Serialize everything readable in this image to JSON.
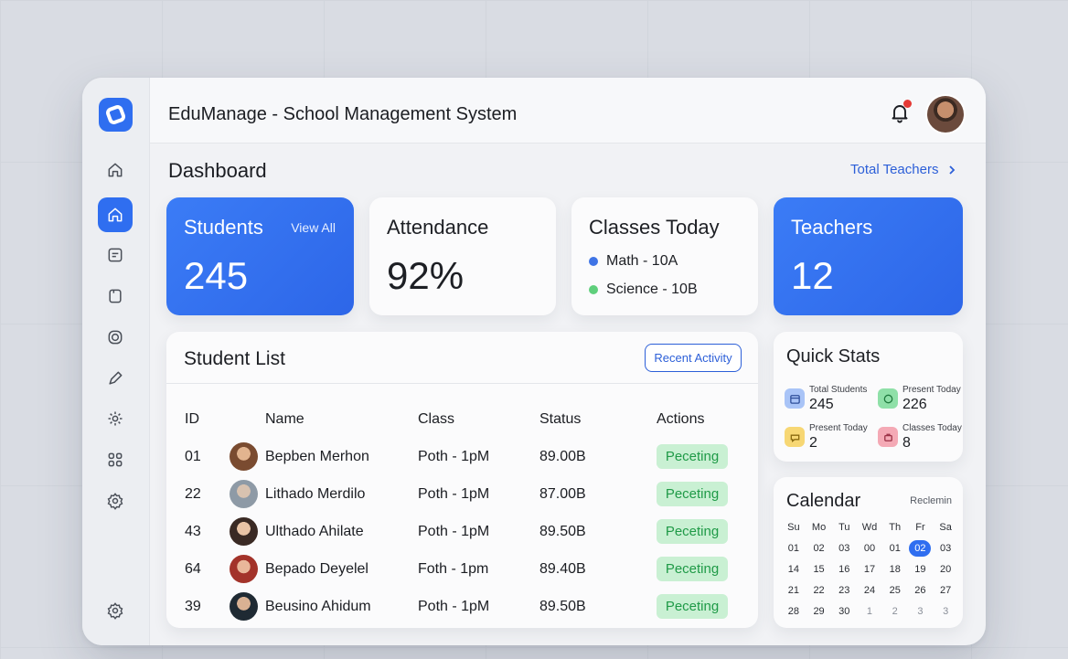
{
  "app": {
    "title": "EduManage - School Management System",
    "accent": "#2f6ef0"
  },
  "sidebar": {
    "items": [
      {
        "name": "home-icon",
        "active": false
      },
      {
        "name": "dashboard-home-icon",
        "active": true
      },
      {
        "name": "gradebook-icon",
        "active": false
      },
      {
        "name": "document-icon",
        "active": false
      },
      {
        "name": "badge-icon",
        "active": false
      },
      {
        "name": "edit-icon",
        "active": false
      },
      {
        "name": "settings-icon",
        "active": false
      },
      {
        "name": "apps-grid-icon",
        "active": false
      },
      {
        "name": "gear-icon",
        "active": false
      }
    ],
    "bottom_icon": "settings-icon"
  },
  "header": {
    "notifications_icon": "bell-icon",
    "avatar_icon": "user-avatar"
  },
  "page": {
    "title": "Dashboard",
    "teachers_link": "Total Teachers"
  },
  "cards": {
    "students": {
      "title": "Students",
      "link": "View All",
      "value": "245"
    },
    "attendance": {
      "title": "Attendance",
      "value": "92%"
    },
    "classes": {
      "title": "Classes Today",
      "items": [
        {
          "label": "Math - 10A",
          "color": "#3f74e6"
        },
        {
          "label": "Science - 10B",
          "color": "#5fcf7c"
        }
      ]
    },
    "teachers": {
      "title": "Teachers",
      "value": "12"
    }
  },
  "student_list": {
    "title": "Student List",
    "recent_button": "Recent Activity",
    "columns": [
      "ID",
      "Name",
      "Class",
      "Status",
      "Actions"
    ],
    "rows": [
      {
        "id": "01",
        "name": "Bepben Merhon",
        "class": "Poth - 1pM",
        "status": "89.00B",
        "action": "Peceting"
      },
      {
        "id": "22",
        "name": "Lithado Merdilo",
        "class": "Poth - 1pM",
        "status": "87.00B",
        "action": "Peceting"
      },
      {
        "id": "43",
        "name": "Ulthado Ahilate",
        "class": "Poth - 1pM",
        "status": "89.50B",
        "action": "Peceting"
      },
      {
        "id": "64",
        "name": "Bepado Deyelel",
        "class": "Foth - 1pm",
        "status": "89.40B",
        "action": "Peceting"
      },
      {
        "id": "39",
        "name": "Beusino Ahidum",
        "class": "Poth - 1pM",
        "status": "89.50B",
        "action": "Peceting"
      }
    ]
  },
  "quick_stats": {
    "title": "Quick Stats",
    "items": [
      {
        "label": "Total Students",
        "value": "245",
        "icon": "calendar-icon",
        "color": "#a9c4f7"
      },
      {
        "label": "Present Today",
        "value": "226",
        "icon": "check-circle-icon",
        "color": "#8fe0a8"
      },
      {
        "label": "Present Today",
        "value": "2",
        "icon": "chat-icon",
        "color": "#f7d774"
      },
      {
        "label": "Classes Today",
        "value": "8",
        "icon": "classroom-icon",
        "color": "#f4a9b5"
      }
    ]
  },
  "calendar": {
    "title": "Calendar",
    "subtitle": "Reclemin",
    "weekdays": [
      "Su",
      "Mo",
      "Tu",
      "Wd",
      "Th",
      "Fr",
      "Sa"
    ],
    "weeks": [
      [
        "01",
        "02",
        "03",
        "00",
        "01",
        "02",
        "03"
      ],
      [
        "14",
        "15",
        "16",
        "17",
        "18",
        "19",
        "20"
      ],
      [
        "21",
        "22",
        "23",
        "24",
        "25",
        "26",
        "27"
      ],
      [
        "28",
        "29",
        "30",
        "1",
        "2",
        "3",
        "3"
      ]
    ],
    "selected": "02"
  }
}
